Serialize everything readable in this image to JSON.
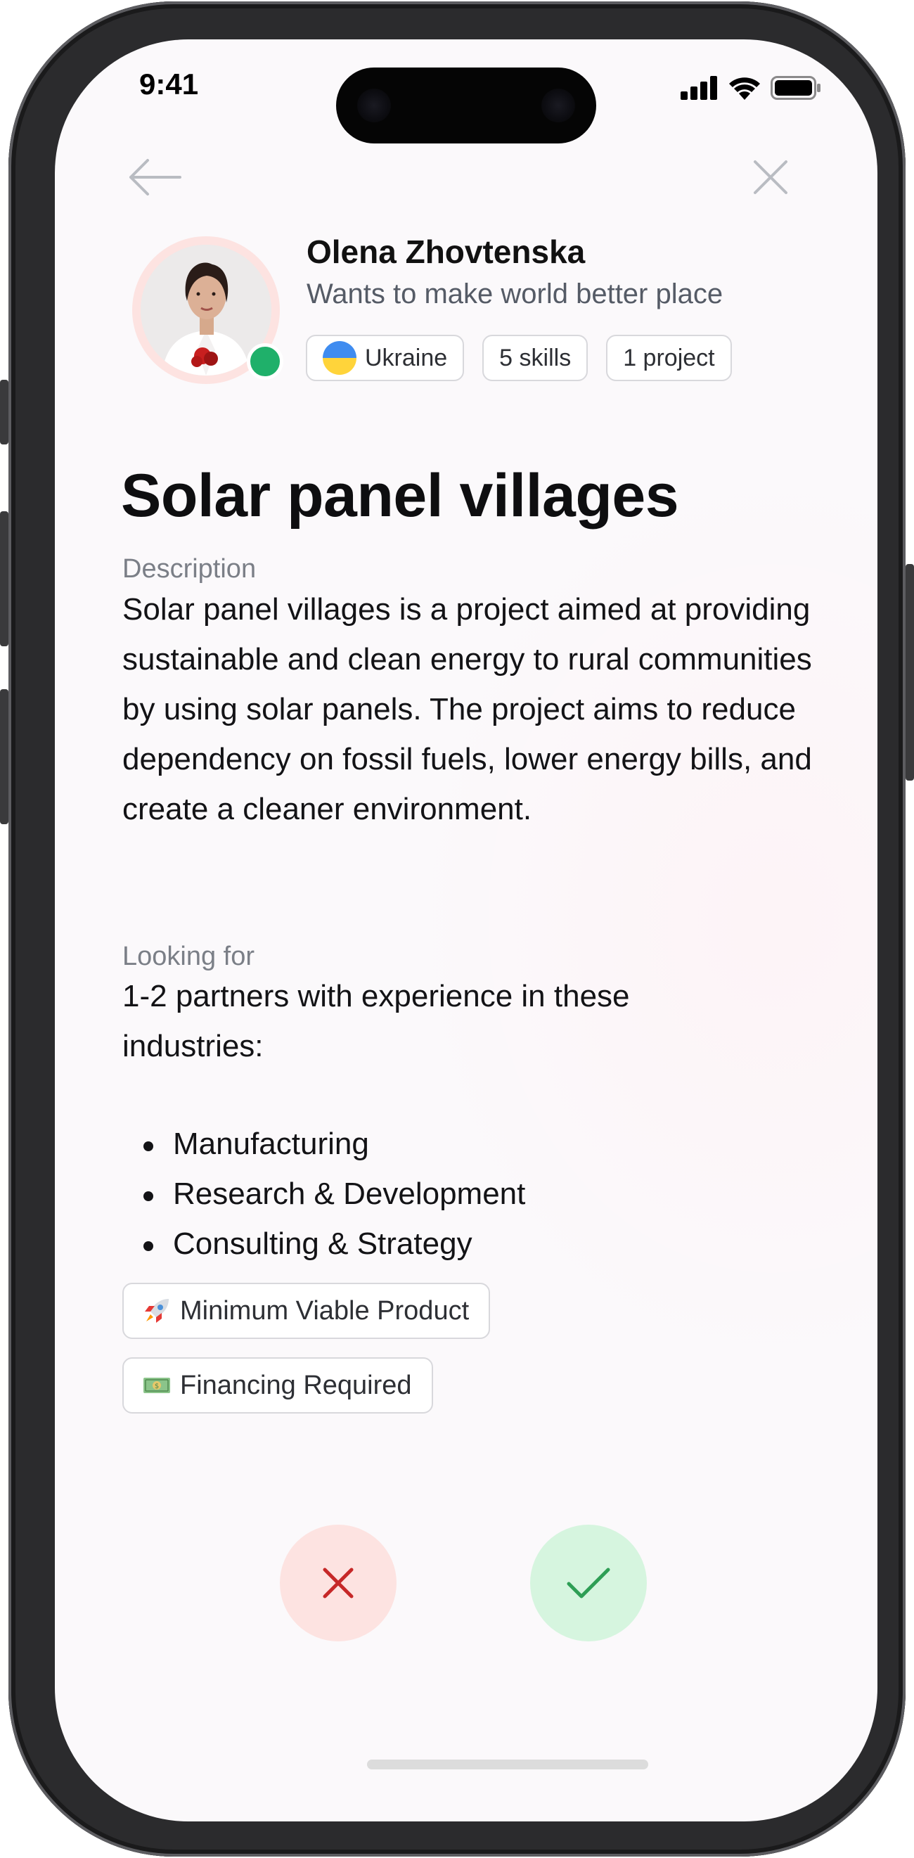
{
  "status_bar": {
    "time": "9:41"
  },
  "profile": {
    "name": "Olena Zhovtenska",
    "tagline": "Wants to make world better place",
    "chips": [
      {
        "label": "Ukraine",
        "icon": "ukraine-flag-icon"
      },
      {
        "label": "5 skills"
      },
      {
        "label": "1 project"
      }
    ],
    "online": true
  },
  "project": {
    "title": "Solar panel villages",
    "description_label": "Description",
    "description": "Solar panel villages is a project aimed at providing sustainable and clean energy to rural communities by using solar panels. The project aims to reduce dependency on fossil fuels, lower energy bills, and create a cleaner environment.",
    "looking_for_label": "Looking for",
    "looking_for": "1-2 partners with experience in these industries:",
    "industries": [
      "Manufacturing",
      "Research & Development",
      "Consulting & Strategy"
    ],
    "tags": [
      {
        "emoji": "rocket-icon",
        "label": "Minimum Viable Product"
      },
      {
        "emoji": "money-icon",
        "label": "Financing Required"
      }
    ]
  },
  "colors": {
    "online": "#1fb06a",
    "reject_bg": "#fde3e1",
    "reject_icon": "#c62828",
    "accept_bg": "#d6f5df",
    "accept_icon": "#2e9e55"
  }
}
